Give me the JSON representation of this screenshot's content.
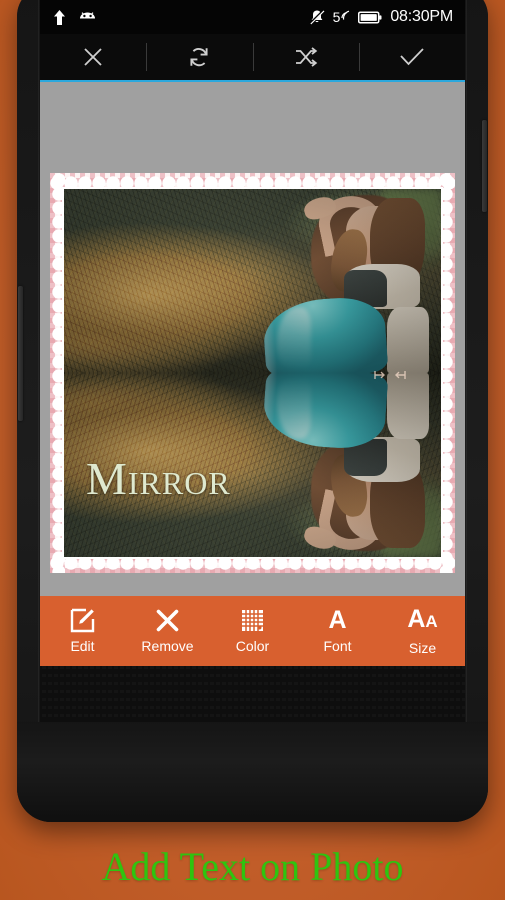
{
  "app": {
    "caption": "Add Text on Photo",
    "accent_orange": "#d8602f",
    "background_orange": "#c45f2c",
    "accent_blue": "#2ba8dd",
    "caption_green": "#2fc40f",
    "canvas_grey": "#a0a0a0"
  },
  "statusbar": {
    "time": "08:30PM",
    "signal_value": "5",
    "icons": {
      "upload": "upload-arrow-icon",
      "android": "android-robot-icon",
      "mute": "silent-mode-icon",
      "signal": "signal-strength-icon",
      "battery": "battery-icon"
    }
  },
  "toolbar": {
    "items": [
      {
        "name": "close",
        "icon": "close-x-icon",
        "label": ""
      },
      {
        "name": "rotate",
        "icon": "rotate-icon",
        "label": ""
      },
      {
        "name": "shuffle",
        "icon": "shuffle-icon",
        "label": ""
      },
      {
        "name": "done",
        "icon": "checkmark-icon",
        "label": ""
      }
    ]
  },
  "photo": {
    "overlay_text": "Mirror",
    "overlay_text_color": "#dfe9cf",
    "frame_style": "pink-gingham-scalloped",
    "mirror_mode": "vertical",
    "subject": "woman-in-teal-dress-on-hay"
  },
  "bottombar": {
    "items": [
      {
        "label": "Edit",
        "icon": "edit-pencil-icon"
      },
      {
        "label": "Remove",
        "icon": "close-x-icon"
      },
      {
        "label": "Color",
        "icon": "color-grid-icon"
      },
      {
        "label": "Font",
        "icon": "font-a-icon"
      },
      {
        "label": "Size",
        "icon": "text-size-icon"
      }
    ]
  }
}
